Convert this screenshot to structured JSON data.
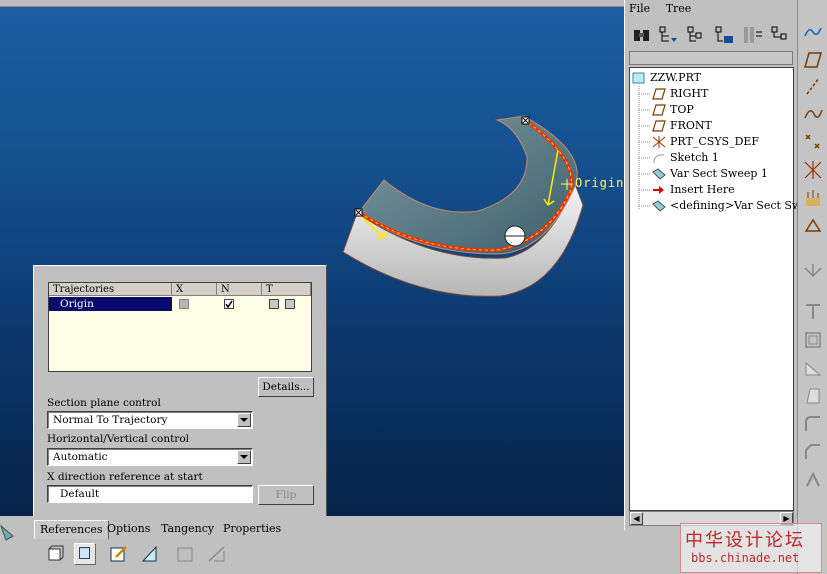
{
  "menu": {
    "file": "File",
    "tree": "Tree"
  },
  "tree": {
    "root": "ZZW.PRT",
    "items": [
      {
        "label": "RIGHT",
        "icon": "datum-plane-icon"
      },
      {
        "label": "TOP",
        "icon": "datum-plane-icon"
      },
      {
        "label": "FRONT",
        "icon": "datum-plane-icon"
      },
      {
        "label": "PRT_CSYS_DEF",
        "icon": "csys-icon"
      },
      {
        "label": "Sketch 1",
        "icon": "sketch-icon"
      },
      {
        "label": "Var Sect Sweep 1",
        "icon": "sweep-icon"
      },
      {
        "label": "Insert Here",
        "icon": "insert-arrow-icon"
      },
      {
        "label": "<defining>Var Sect Sweep",
        "icon": "sweep-icon"
      }
    ]
  },
  "viewport": {
    "origin_label": "Origin"
  },
  "references": {
    "table": {
      "headers": [
        "Trajectories",
        "X",
        "N",
        "T"
      ],
      "rows": [
        {
          "name": "Origin",
          "x": false,
          "n": true,
          "t": false
        }
      ]
    },
    "details_button": "Details...",
    "section_plane_label": "Section plane control",
    "section_plane_value": "Normal To Trajectory",
    "hv_control_label": "Horizontal/Vertical control",
    "hv_control_value": "Automatic",
    "x_dir_label": "X direction reference at start",
    "x_dir_value": "Default",
    "flip_button": "Flip"
  },
  "dashboard": {
    "tabs": [
      "References",
      "Options",
      "Tangency",
      "Properties"
    ],
    "active_tab": "References"
  },
  "watermark": {
    "line1": "中华设计论坛",
    "line2": "bbs.chinade.net"
  },
  "colors": {
    "viewport_top": "#1c5fa2",
    "viewport_bottom": "#062448",
    "trajectory": "#ff2a00",
    "highlight_row": "#0a0a6e"
  }
}
